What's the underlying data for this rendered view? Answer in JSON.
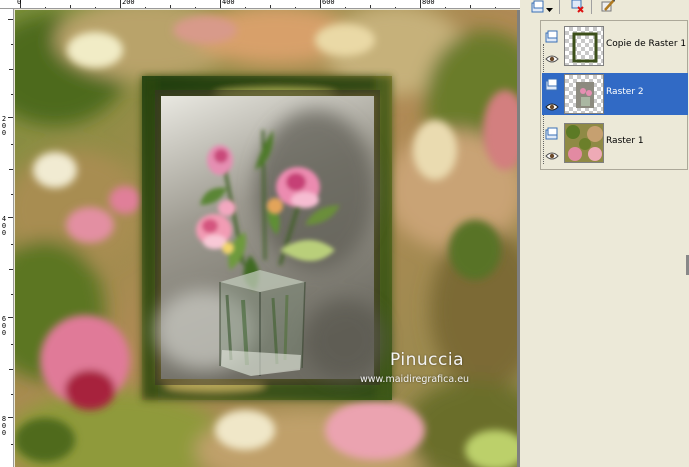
{
  "ruler": {
    "top_labels": [
      "0",
      "200",
      "400",
      "600",
      "800"
    ],
    "left_labels": [
      "2\n0\n0",
      "4\n0\n0",
      "6\n0\n0",
      "8\n0\n0"
    ]
  },
  "canvas": {
    "watermark_title": "Pinuccia",
    "watermark_url": "www.maidiregrafica.eu"
  },
  "layers_panel": {
    "toolbar": {
      "new_layer_icon": "new-raster-layer-icon",
      "dropdown_icon": "chevron-down-icon",
      "delete_icon": "delete-layer-icon",
      "properties_icon": "layer-properties-icon"
    },
    "layers": [
      {
        "name": "Copie de Raster 1",
        "selected": false,
        "thumb": "frame"
      },
      {
        "name": "Raster 2",
        "selected": true,
        "thumb": "flowers"
      },
      {
        "name": "Raster 1",
        "selected": false,
        "thumb": "background"
      }
    ]
  },
  "colors": {
    "selection": "#316ac5",
    "panel_bg": "#ece9d8"
  }
}
